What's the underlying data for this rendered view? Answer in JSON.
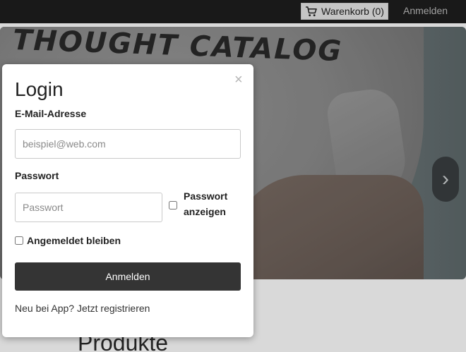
{
  "nav": {
    "cart_label": "Warenkorb (0)",
    "login_label": "Anmelden",
    "cart_icon": "shopping-cart-icon"
  },
  "hero": {
    "shirt_text": "THOUGHT CATALOG",
    "next_arrow": "›"
  },
  "page": {
    "section_heading": "Produkte"
  },
  "modal": {
    "title": "Login",
    "close_symbol": "×",
    "email_label": "E-Mail-Adresse",
    "email_placeholder": "beispiel@web.com",
    "email_value": "",
    "password_label": "Passwort",
    "password_placeholder": "Passwort",
    "password_value": "",
    "show_password_label": "Passwort anzeigen",
    "show_password_checked": false,
    "remember_label": "Angemeldet bleiben",
    "remember_checked": false,
    "submit_label": "Anmelden",
    "register_prefix": "Neu bei App?",
    "register_link": "Jetzt registrieren"
  },
  "colors": {
    "nav_bg": "#1e1e1e",
    "button_bg": "#343434",
    "modal_bg": "#ffffff"
  }
}
